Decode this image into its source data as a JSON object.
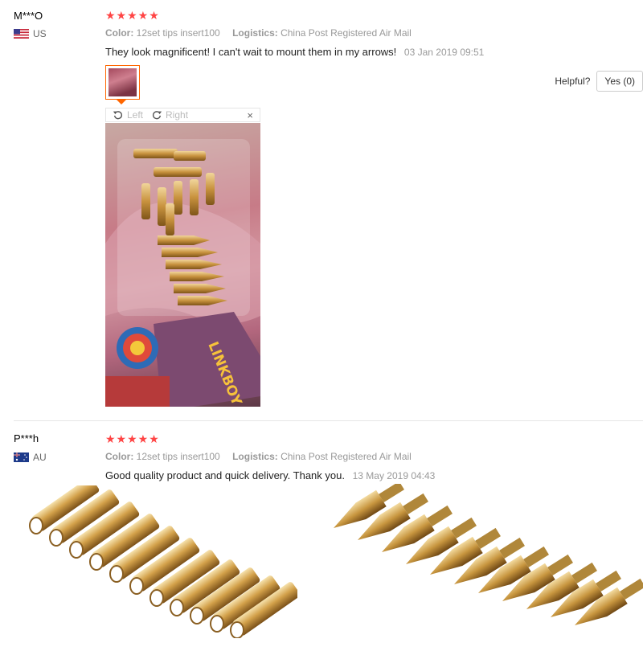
{
  "reviews": [
    {
      "user": "M***O",
      "country_code": "US",
      "rating": "★★★★★",
      "color_label": "Color:",
      "color_value": "12set tips insert100",
      "logistics_label": "Logistics:",
      "logistics_value": "China Post Registered Air Mail",
      "text": "They look magnificent! I can't wait to mount them in my arrows!",
      "date": "03 Jan 2019 09:51",
      "helpful_label": "Helpful?",
      "helpful_yes": "Yes (0)",
      "viewer": {
        "rotate_left": "Left",
        "rotate_right": "Right",
        "close": "×"
      },
      "photo_text": "LINKBOY OUTDOOR"
    },
    {
      "user": "P***h",
      "country_code": "AU",
      "rating": "★★★★★",
      "color_label": "Color:",
      "color_value": "12set tips insert100",
      "logistics_label": "Logistics:",
      "logistics_value": "China Post Registered Air Mail",
      "text": "Good quality product and quick delivery. Thank you.",
      "date": "13 May 2019 04:43"
    }
  ],
  "colors": {
    "star": "#ff4444",
    "accent": "#ff6600",
    "muted": "#999999"
  },
  "icons": [
    "us-flag-icon",
    "au-flag-icon",
    "rotate-left-icon",
    "rotate-right-icon",
    "close-icon"
  ]
}
